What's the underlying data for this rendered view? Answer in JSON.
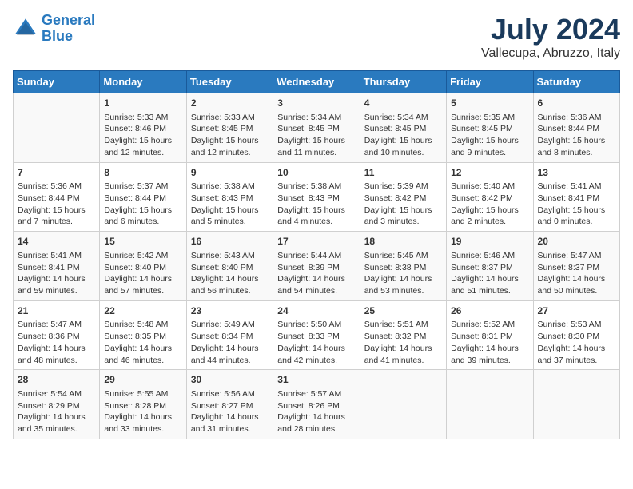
{
  "logo": {
    "line1": "General",
    "line2": "Blue"
  },
  "title": "July 2024",
  "subtitle": "Vallecupa, Abruzzo, Italy",
  "header_colors": {
    "bg": "#2a7abf",
    "text": "#ffffff"
  },
  "days_of_week": [
    "Sunday",
    "Monday",
    "Tuesday",
    "Wednesday",
    "Thursday",
    "Friday",
    "Saturday"
  ],
  "weeks": [
    {
      "cells": [
        {
          "day": "",
          "info": ""
        },
        {
          "day": "1",
          "info": "Sunrise: 5:33 AM\nSunset: 8:46 PM\nDaylight: 15 hours\nand 12 minutes."
        },
        {
          "day": "2",
          "info": "Sunrise: 5:33 AM\nSunset: 8:45 PM\nDaylight: 15 hours\nand 12 minutes."
        },
        {
          "day": "3",
          "info": "Sunrise: 5:34 AM\nSunset: 8:45 PM\nDaylight: 15 hours\nand 11 minutes."
        },
        {
          "day": "4",
          "info": "Sunrise: 5:34 AM\nSunset: 8:45 PM\nDaylight: 15 hours\nand 10 minutes."
        },
        {
          "day": "5",
          "info": "Sunrise: 5:35 AM\nSunset: 8:45 PM\nDaylight: 15 hours\nand 9 minutes."
        },
        {
          "day": "6",
          "info": "Sunrise: 5:36 AM\nSunset: 8:44 PM\nDaylight: 15 hours\nand 8 minutes."
        }
      ]
    },
    {
      "cells": [
        {
          "day": "7",
          "info": "Sunrise: 5:36 AM\nSunset: 8:44 PM\nDaylight: 15 hours\nand 7 minutes."
        },
        {
          "day": "8",
          "info": "Sunrise: 5:37 AM\nSunset: 8:44 PM\nDaylight: 15 hours\nand 6 minutes."
        },
        {
          "day": "9",
          "info": "Sunrise: 5:38 AM\nSunset: 8:43 PM\nDaylight: 15 hours\nand 5 minutes."
        },
        {
          "day": "10",
          "info": "Sunrise: 5:38 AM\nSunset: 8:43 PM\nDaylight: 15 hours\nand 4 minutes."
        },
        {
          "day": "11",
          "info": "Sunrise: 5:39 AM\nSunset: 8:42 PM\nDaylight: 15 hours\nand 3 minutes."
        },
        {
          "day": "12",
          "info": "Sunrise: 5:40 AM\nSunset: 8:42 PM\nDaylight: 15 hours\nand 2 minutes."
        },
        {
          "day": "13",
          "info": "Sunrise: 5:41 AM\nSunset: 8:41 PM\nDaylight: 15 hours\nand 0 minutes."
        }
      ]
    },
    {
      "cells": [
        {
          "day": "14",
          "info": "Sunrise: 5:41 AM\nSunset: 8:41 PM\nDaylight: 14 hours\nand 59 minutes."
        },
        {
          "day": "15",
          "info": "Sunrise: 5:42 AM\nSunset: 8:40 PM\nDaylight: 14 hours\nand 57 minutes."
        },
        {
          "day": "16",
          "info": "Sunrise: 5:43 AM\nSunset: 8:40 PM\nDaylight: 14 hours\nand 56 minutes."
        },
        {
          "day": "17",
          "info": "Sunrise: 5:44 AM\nSunset: 8:39 PM\nDaylight: 14 hours\nand 54 minutes."
        },
        {
          "day": "18",
          "info": "Sunrise: 5:45 AM\nSunset: 8:38 PM\nDaylight: 14 hours\nand 53 minutes."
        },
        {
          "day": "19",
          "info": "Sunrise: 5:46 AM\nSunset: 8:37 PM\nDaylight: 14 hours\nand 51 minutes."
        },
        {
          "day": "20",
          "info": "Sunrise: 5:47 AM\nSunset: 8:37 PM\nDaylight: 14 hours\nand 50 minutes."
        }
      ]
    },
    {
      "cells": [
        {
          "day": "21",
          "info": "Sunrise: 5:47 AM\nSunset: 8:36 PM\nDaylight: 14 hours\nand 48 minutes."
        },
        {
          "day": "22",
          "info": "Sunrise: 5:48 AM\nSunset: 8:35 PM\nDaylight: 14 hours\nand 46 minutes."
        },
        {
          "day": "23",
          "info": "Sunrise: 5:49 AM\nSunset: 8:34 PM\nDaylight: 14 hours\nand 44 minutes."
        },
        {
          "day": "24",
          "info": "Sunrise: 5:50 AM\nSunset: 8:33 PM\nDaylight: 14 hours\nand 42 minutes."
        },
        {
          "day": "25",
          "info": "Sunrise: 5:51 AM\nSunset: 8:32 PM\nDaylight: 14 hours\nand 41 minutes."
        },
        {
          "day": "26",
          "info": "Sunrise: 5:52 AM\nSunset: 8:31 PM\nDaylight: 14 hours\nand 39 minutes."
        },
        {
          "day": "27",
          "info": "Sunrise: 5:53 AM\nSunset: 8:30 PM\nDaylight: 14 hours\nand 37 minutes."
        }
      ]
    },
    {
      "cells": [
        {
          "day": "28",
          "info": "Sunrise: 5:54 AM\nSunset: 8:29 PM\nDaylight: 14 hours\nand 35 minutes."
        },
        {
          "day": "29",
          "info": "Sunrise: 5:55 AM\nSunset: 8:28 PM\nDaylight: 14 hours\nand 33 minutes."
        },
        {
          "day": "30",
          "info": "Sunrise: 5:56 AM\nSunset: 8:27 PM\nDaylight: 14 hours\nand 31 minutes."
        },
        {
          "day": "31",
          "info": "Sunrise: 5:57 AM\nSunset: 8:26 PM\nDaylight: 14 hours\nand 28 minutes."
        },
        {
          "day": "",
          "info": ""
        },
        {
          "day": "",
          "info": ""
        },
        {
          "day": "",
          "info": ""
        }
      ]
    }
  ]
}
